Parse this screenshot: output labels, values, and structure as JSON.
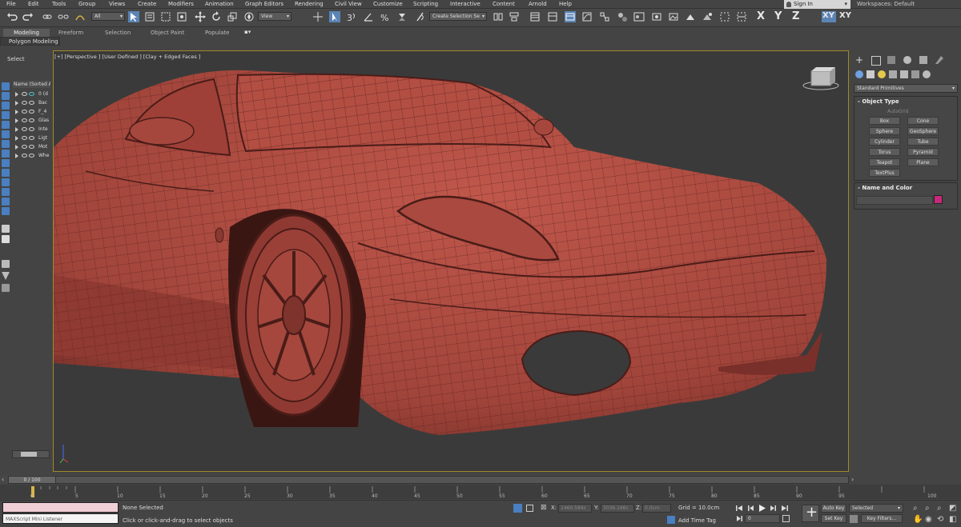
{
  "menu": [
    "File",
    "Edit",
    "Tools",
    "Group",
    "Views",
    "Create",
    "Modifiers",
    "Animation",
    "Graph Editors",
    "Rendering",
    "Civil View",
    "Customize",
    "Scripting",
    "Interactive",
    "Content",
    "Arnold",
    "Help"
  ],
  "account": {
    "sign_in": "Sign In",
    "workspaces_label": "Workspaces:",
    "workspace": "Default"
  },
  "toolbar": {
    "selection_filter": "All",
    "ref_coord": "View",
    "named_selection": "Create Selection Se",
    "axis_x": "X",
    "axis_y": "Y",
    "axis_z": "Z",
    "axis_xy": "XY",
    "axis_xy2": "XY"
  },
  "ribbon": {
    "tabs": [
      "Modeling",
      "Freeform",
      "Selection",
      "Object Paint",
      "Populate"
    ],
    "sub_label": "Polygon Modeling"
  },
  "scene_explorer": {
    "select_label": "Select",
    "header": "Name (Sorted A",
    "rows": [
      "0 (d",
      "Bac",
      "F_4",
      "Glas",
      "Inte",
      "Ligt",
      "Mot",
      "Whe"
    ]
  },
  "viewport": {
    "label": "[+] [Perspective ] [User Defined ] [Clay + Edged Faces ]"
  },
  "command_panel": {
    "category": "Standard Primitives",
    "object_type_title": "Object Type",
    "autogrid": "AutoGrid",
    "buttons": [
      "Box",
      "Cone",
      "Sphere",
      "GeoSphere",
      "Cylinder",
      "Tube",
      "Torus",
      "Pyramid",
      "Teapot",
      "Plane",
      "TextPlus"
    ],
    "name_color_title": "Name and Color"
  },
  "timeline": {
    "slider": "0 / 100",
    "ticks": [
      "0",
      "5",
      "10",
      "15",
      "20",
      "25",
      "30",
      "35",
      "40",
      "45",
      "50",
      "55",
      "60",
      "65",
      "70",
      "75",
      "80",
      "85",
      "90",
      "95",
      "100"
    ]
  },
  "status": {
    "maxscript": "MAXScript Mini Listener",
    "selection": "None Selected",
    "prompt": "Click or click-and-drag to select objects",
    "x_label": "X:",
    "x_value": "1460.584c",
    "y_label": "Y:",
    "y_value": "3036.166c",
    "z_label": "Z:",
    "z_value": "0.0cm",
    "grid": "Grid = 10.0cm",
    "add_time_tag": "Add Time Tag",
    "frame": "0",
    "auto_key": "Auto Key",
    "set_key": "Set Key",
    "key_mode": "Selected",
    "key_filters": "Key Filters..."
  },
  "colors": {
    "car": "#a94a40",
    "viewport_border": "#a08a2a",
    "accent": "#5b84b5"
  }
}
